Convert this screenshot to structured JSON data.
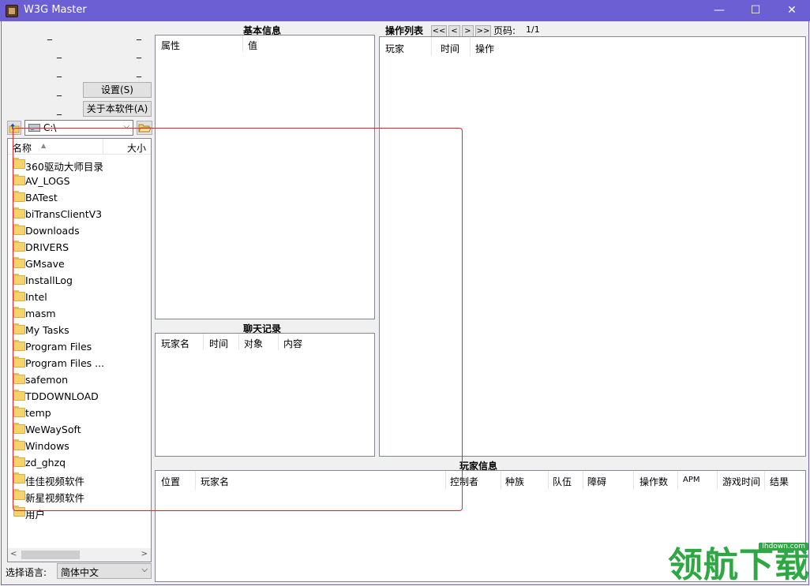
{
  "window": {
    "title": "W3G Master",
    "minimize": "—",
    "maximize": "☐",
    "close": "✕",
    "accent": "#6b5fd3"
  },
  "left": {
    "dash": "_",
    "settings_button": "设置(S)",
    "about_button": "关于本软件(A)",
    "drive": "C:\\",
    "drive_chevron": "⌵",
    "list_header": {
      "name": "名称",
      "size": "大小",
      "sort_arrow": "▲"
    },
    "files": [
      "360驱动大师目录",
      "AV_LOGS",
      "BATest",
      "biTransClientV3",
      "Downloads",
      "DRIVERS",
      "GMsave",
      "InstallLog",
      "Intel",
      "masm",
      "My Tasks",
      "Program Files",
      "Program Files ...",
      "safemon",
      "TDDOWNLOAD",
      "temp",
      "WeWaySoft",
      "Windows",
      "zd_ghzq",
      "佳佳视频软件",
      "新星视频软件",
      "用户"
    ],
    "scroll_left": "<",
    "scroll_right": ">",
    "language_label": "选择语言:",
    "language_value": "简体中文",
    "language_chevron": "⌵"
  },
  "basic_info": {
    "title": "基本信息",
    "columns": [
      "属性",
      "值"
    ]
  },
  "chat": {
    "title": "聊天记录",
    "columns": [
      "玩家名",
      "时间",
      "对象",
      "内容"
    ]
  },
  "actions": {
    "title": "操作列表",
    "pager": [
      "<<",
      "<",
      ">",
      ">>"
    ],
    "page_label": "页码:",
    "page_value": "1/1",
    "columns": [
      "玩家",
      "时间",
      "操作"
    ]
  },
  "players": {
    "title": "玩家信息",
    "columns": [
      "位置",
      "玩家名",
      "控制者",
      "种族",
      "队伍",
      "障碍",
      "操作数",
      "APM",
      "游戏时间",
      "结果"
    ]
  },
  "watermark": {
    "text": "领航下载",
    "url": "lhdown.com"
  }
}
